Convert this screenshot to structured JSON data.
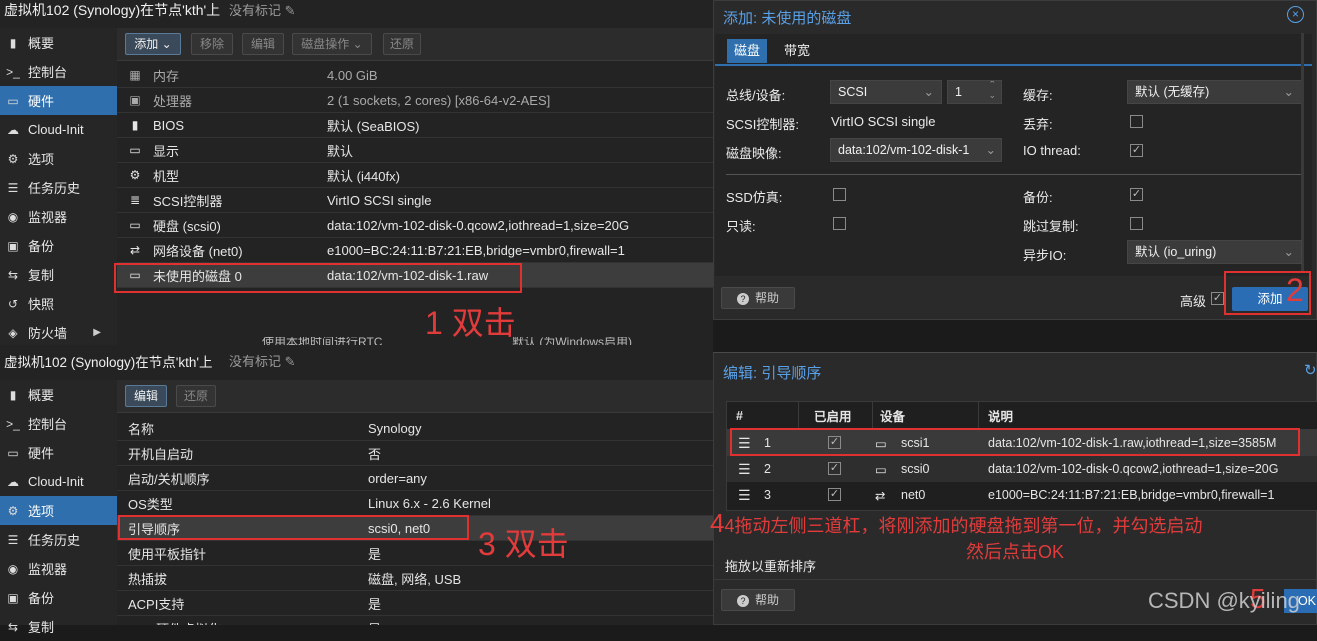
{
  "top": {
    "title": "虚拟机102 (Synology)在节点'kth'上",
    "tag": "没有标记"
  },
  "bottom": {
    "title": "虚拟机102 (Synology)在节点'kth'上",
    "tag": "没有标记"
  },
  "sidebar_top": [
    {
      "icon": "book-icon",
      "glyph": "▮",
      "label": "概要"
    },
    {
      "icon": "terminal-icon",
      "glyph": ">_",
      "label": "控制台"
    },
    {
      "icon": "monitor-icon",
      "glyph": "▭",
      "label": "硬件"
    },
    {
      "icon": "cloud-icon",
      "glyph": "☁",
      "label": "Cloud-Init"
    },
    {
      "icon": "gear-icon",
      "glyph": "⚙",
      "label": "选项"
    },
    {
      "icon": "list-icon",
      "glyph": "☰",
      "label": "任务历史"
    },
    {
      "icon": "eye-icon",
      "glyph": "◉",
      "label": "监视器"
    },
    {
      "icon": "floppy-icon",
      "glyph": "▣",
      "label": "备份"
    },
    {
      "icon": "retweet-icon",
      "glyph": "⇆",
      "label": "复制"
    },
    {
      "icon": "history-icon",
      "glyph": "↺",
      "label": "快照"
    },
    {
      "icon": "shield-icon",
      "glyph": "◈",
      "label": "防火墙"
    }
  ],
  "sidebar_bottom": [
    {
      "icon": "book-icon",
      "glyph": "▮",
      "label": "概要"
    },
    {
      "icon": "terminal-icon",
      "glyph": ">_",
      "label": "控制台"
    },
    {
      "icon": "monitor-icon",
      "glyph": "▭",
      "label": "硬件"
    },
    {
      "icon": "cloud-icon",
      "glyph": "☁",
      "label": "Cloud-Init"
    },
    {
      "icon": "gear-icon",
      "glyph": "⚙",
      "label": "选项"
    },
    {
      "icon": "list-icon",
      "glyph": "☰",
      "label": "任务历史"
    },
    {
      "icon": "eye-icon",
      "glyph": "◉",
      "label": "监视器"
    },
    {
      "icon": "floppy-icon",
      "glyph": "▣",
      "label": "备份"
    },
    {
      "icon": "retweet-icon",
      "glyph": "⇆",
      "label": "复制"
    }
  ],
  "hw_toolbar": {
    "add": "添加",
    "remove": "移除",
    "edit": "编辑",
    "disk_action": "磁盘操作",
    "revert": "还原"
  },
  "hardware": [
    {
      "icon": "memory-icon",
      "glyph": "▦",
      "key": "内存",
      "value": "4.00 GiB",
      "dim": true
    },
    {
      "icon": "cpu-icon",
      "glyph": "▣",
      "key": "处理器",
      "value": "2 (1 sockets, 2 cores) [x86-64-v2-AES]",
      "dim": true
    },
    {
      "icon": "chip-icon",
      "glyph": "▮",
      "key": "BIOS",
      "value": "默认 (SeaBIOS)"
    },
    {
      "icon": "desktop-icon",
      "glyph": "▭",
      "key": "显示",
      "value": "默认"
    },
    {
      "icon": "cogs-icon",
      "glyph": "⚙",
      "key": "机型",
      "value": "默认 (i440fx)"
    },
    {
      "icon": "database-icon",
      "glyph": "≣",
      "key": "SCSI控制器",
      "value": "VirtIO SCSI single"
    },
    {
      "icon": "hdd-icon",
      "glyph": "▭",
      "key": "硬盘 (scsi0)",
      "value": "data:102/vm-102-disk-0.qcow2,iothread=1,size=20G"
    },
    {
      "icon": "exchange-icon",
      "glyph": "⇄",
      "key": "网络设备 (net0)",
      "value": "e1000=BC:24:11:B7:21:EB,bridge=vmbr0,firewall=1"
    },
    {
      "icon": "hdd-icon",
      "glyph": "▭",
      "key": "未使用的磁盘 0",
      "value": "data:102/vm-102-disk-1.raw"
    }
  ],
  "hw_partial_row": {
    "key": "使用本地时间进行RTC",
    "value": "默认 (为Windows启用)"
  },
  "annotations": {
    "a1": "1 双击",
    "a2": "2",
    "a3": "3 双击",
    "a4_line1": "4拖动左侧三道杠，将刚添加的硬盘拖到第一位，并勾选启动",
    "a4_line2": "然后点击OK",
    "a5": "5"
  },
  "add_dialog": {
    "title": "添加: 未使用的磁盘",
    "tabs": [
      "磁盘",
      "带宽"
    ],
    "bus_label": "总线/设备:",
    "bus": "SCSI",
    "device_no": "1",
    "scsi_ctrl_label": "SCSI控制器:",
    "scsi_ctrl": "VirtIO SCSI single",
    "image_label": "磁盘映像:",
    "image": "data:102/vm-102-disk-1",
    "cache_label": "缓存:",
    "cache": "默认 (无缓存)",
    "discard_label": "丢弃:",
    "iothread_label": "IO thread:",
    "ssd_label": "SSD仿真:",
    "readonly_label": "只读:",
    "backup_label": "备份:",
    "skip_repl_label": "跳过复制:",
    "async_label": "异步IO:",
    "async": "默认 (io_uring)",
    "help": "帮助",
    "advanced": "高级",
    "add": "添加"
  },
  "opt_toolbar": {
    "edit": "编辑",
    "revert": "还原"
  },
  "options": [
    {
      "key": "名称",
      "value": "Synology"
    },
    {
      "key": "开机自启动",
      "value": "否"
    },
    {
      "key": "启动/关机顺序",
      "value": "order=any"
    },
    {
      "key": "OS类型",
      "value": "Linux 6.x - 2.6 Kernel"
    },
    {
      "key": "引导顺序",
      "value": "scsi0, net0"
    },
    {
      "key": "使用平板指针",
      "value": "是"
    },
    {
      "key": "热插拔",
      "value": "磁盘, 网络, USB"
    },
    {
      "key": "ACPI支持",
      "value": "是"
    },
    {
      "key": "KVM硬件虚拟化",
      "value": "是"
    }
  ],
  "boot_dialog": {
    "title": "编辑: 引导顺序",
    "headers": [
      "#",
      "已启用",
      "设备",
      "说明"
    ],
    "rows": [
      {
        "n": "1",
        "device": "scsi1",
        "desc": "data:102/vm-102-disk-1.raw,iothread=1,size=3585M",
        "dev_icon": "hdd-icon",
        "dev_glyph": "▭"
      },
      {
        "n": "2",
        "device": "scsi0",
        "desc": "data:102/vm-102-disk-0.qcow2,iothread=1,size=20G",
        "dev_icon": "hdd-icon",
        "dev_glyph": "▭"
      },
      {
        "n": "3",
        "device": "net0",
        "desc": "e1000=BC:24:11:B7:21:EB,bridge=vmbr0,firewall=1",
        "dev_icon": "exchange-icon",
        "dev_glyph": "⇄"
      }
    ],
    "hint": "拖放以重新排序",
    "help": "帮助",
    "ok": "OK"
  },
  "watermark": "CSDN @kyiling"
}
